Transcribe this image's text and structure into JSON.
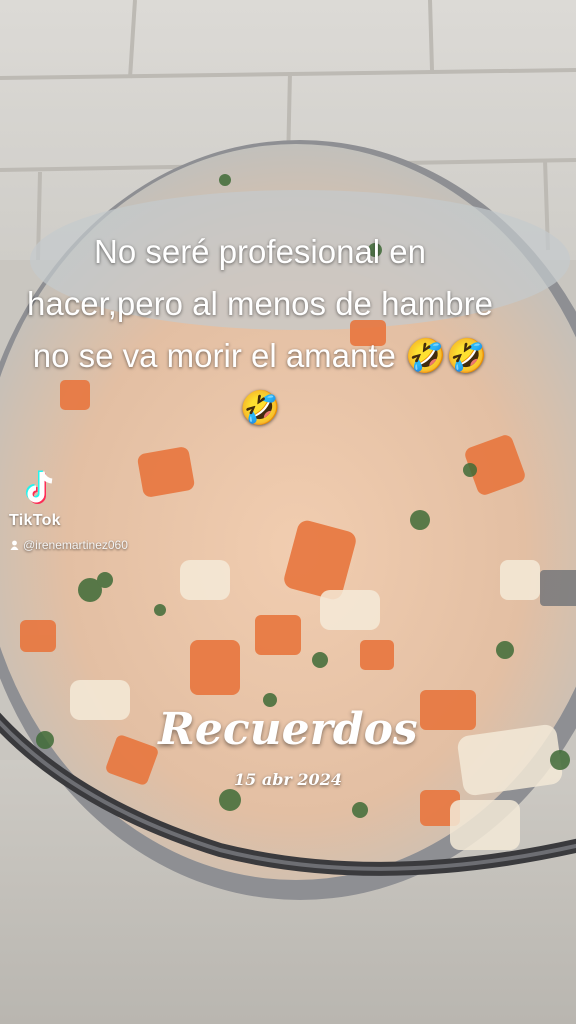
{
  "overlay": {
    "caption": "No seré profesional en hacer,pero al menos de hambre no se va morir el amante 🤣🤣🤣"
  },
  "watermark": {
    "brand": "TikTok",
    "username": "@irenemartinez060",
    "icon": "tiktok-logo-icon"
  },
  "memories": {
    "title": "Recuerdos",
    "date": "15 abr 2024"
  },
  "colors": {
    "tile_wall": "#d8d6d2",
    "soup_broth": "#e8c3a2",
    "pot_rim": "#3a3a3d",
    "carrot": "#e8763e"
  }
}
